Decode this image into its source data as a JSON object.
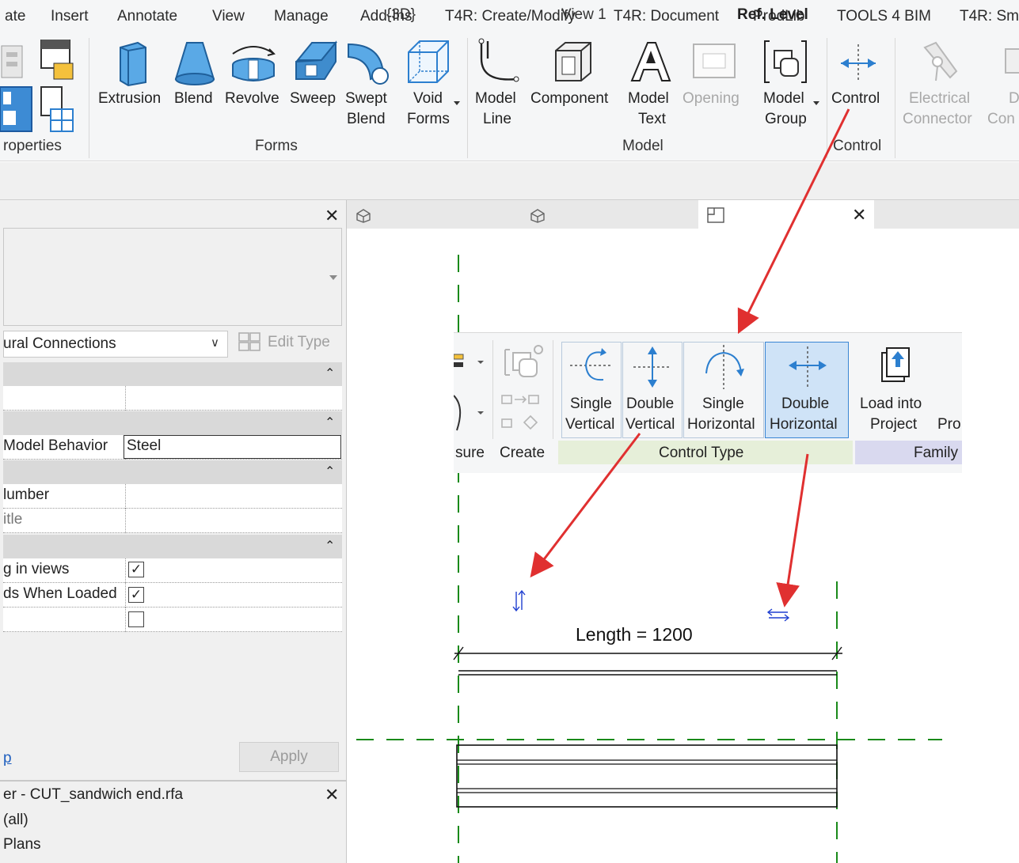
{
  "menu_tabs": [
    "ate",
    "Insert",
    "Annotate",
    "View",
    "Manage",
    "Add-Ins",
    "T4R: Create/Modify",
    "T4R: Document",
    "ProdLib",
    "TOOLS 4 BIM",
    "T4R: Sm"
  ],
  "ribbon": {
    "forms": {
      "extrusion": "Extrusion",
      "blend": "Blend",
      "revolve": "Revolve",
      "sweep": "Sweep",
      "swept_blend_1": "Swept",
      "swept_blend_2": "Blend",
      "void_forms_1": "Void",
      "void_forms_2": "Forms",
      "panel": "Forms"
    },
    "model": {
      "model_line_1": "Model",
      "model_line_2": "Line",
      "component": "Component",
      "model_text_1": "Model",
      "model_text_2": "Text",
      "opening": "Opening",
      "model_group_1": "Model",
      "model_group_2": "Group",
      "panel": "Model"
    },
    "control": {
      "control": "Control",
      "panel": "Control"
    },
    "connectors": {
      "electrical_1": "Electrical",
      "electrical_2": "Connector",
      "next_1": "D",
      "next_2": "Con"
    },
    "properties_panel": "roperties"
  },
  "properties": {
    "type_selector": "ural Connections",
    "edit_type": "Edit Type",
    "rows": {
      "model_behavior_label": "Model Behavior",
      "model_behavior_value": "Steel",
      "number_label": "lumber",
      "title_label": "itle",
      "views_label": "g in views",
      "loaded_label": "ds When Loaded"
    },
    "help_link": "p",
    "apply": "Apply"
  },
  "project_browser": {
    "title": "er - CUT_sandwich end.rfa",
    "items": [
      "(all)",
      "Plans"
    ]
  },
  "view_tabs": [
    {
      "label": "{3D}"
    },
    {
      "label": "View 1"
    },
    {
      "label": "Ref. Level"
    }
  ],
  "inset_ribbon": {
    "single_vertical_1": "Single",
    "single_vertical_2": "Vertical",
    "double_vertical_1": "Double",
    "double_vertical_2": "Vertical",
    "single_horizontal_1": "Single",
    "single_horizontal_2": "Horizontal",
    "double_horizontal_1": "Double",
    "double_horizontal_2": "Horizontal",
    "load_into_project_1": "Load into",
    "load_into_project_2": "Project",
    "load_next": "Pro",
    "measure_panel": "sure",
    "create_panel": "Create",
    "control_type_panel": "Control Type",
    "family_panel": "Family"
  },
  "canvas": {
    "dimension_text": "Length = 1200"
  },
  "colors": {
    "arrow": "#e03030",
    "ref_plane": "#1a8a1a",
    "control_glyph": "#1f3fd0",
    "selected_button": "#cfe3f7"
  }
}
